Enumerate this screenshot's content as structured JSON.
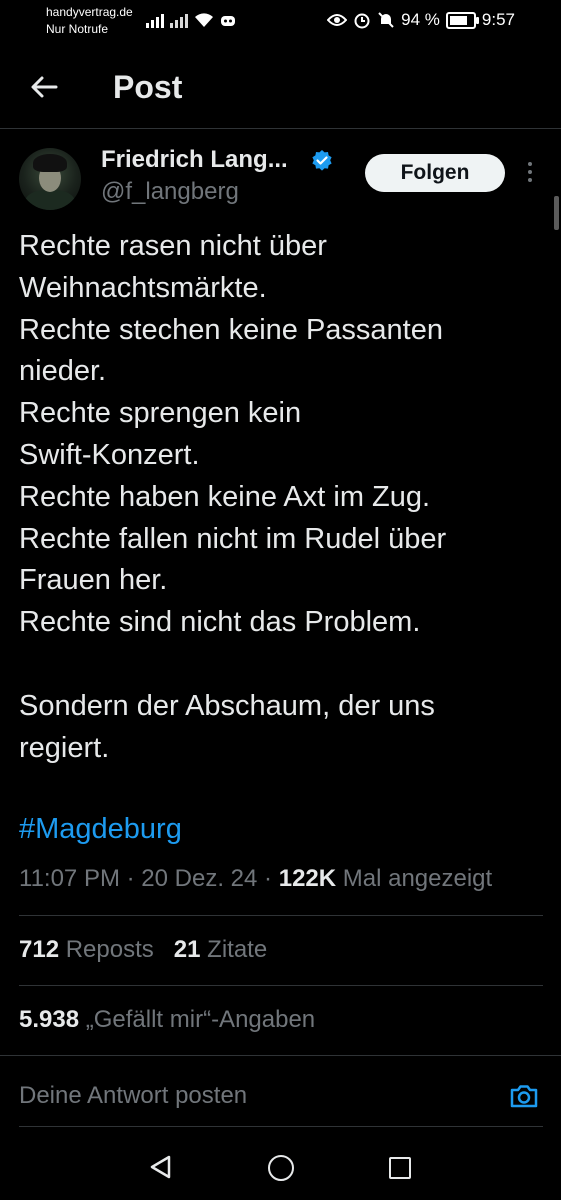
{
  "status_bar": {
    "carrier_line1": "handyvertrag.de",
    "carrier_line2": "Nur Notrufe",
    "battery_percent": "94 %",
    "battery_level": 0.94,
    "time": "9:57"
  },
  "header": {
    "title": "Post",
    "back_icon": "arrow-left-icon"
  },
  "author": {
    "name": "Friedrich Lang...",
    "handle": "@f_langberg",
    "verified_icon": "verified-badge-icon",
    "follow_label": "Folgen"
  },
  "post": {
    "lines": [
      "Rechte rasen nicht über",
      "Weihnachtsmärkte.",
      "Rechte stechen keine Passanten",
      "nieder.",
      "Rechte sprengen kein",
      "Swift-Konzert.",
      "Rechte haben keine Axt im Zug.",
      "Rechte fallen nicht im Rudel über",
      "Frauen her.",
      "Rechte sind nicht das Problem."
    ],
    "lines2": [
      "Sondern der Abschaum, der uns",
      "regiert."
    ],
    "hashtag": "#Magdeburg",
    "time": "11:07 PM",
    "sep": "·",
    "date": "20 Dez. 24",
    "views_count": "122K",
    "views_label": "Mal angezeigt"
  },
  "stats": {
    "reposts_count": "712",
    "reposts_label": "Reposts",
    "quotes_count": "21",
    "quotes_label": "Zitate",
    "likes_count": "5.938",
    "likes_label": "„Gefällt mir“-Angaben"
  },
  "reply": {
    "placeholder": "Deine Antwort posten",
    "camera_icon": "camera-icon"
  },
  "colors": {
    "background": "#000000",
    "link": "#1d9bf0",
    "secondary_text": "#71767b",
    "primary_text": "#e7e9ea"
  }
}
